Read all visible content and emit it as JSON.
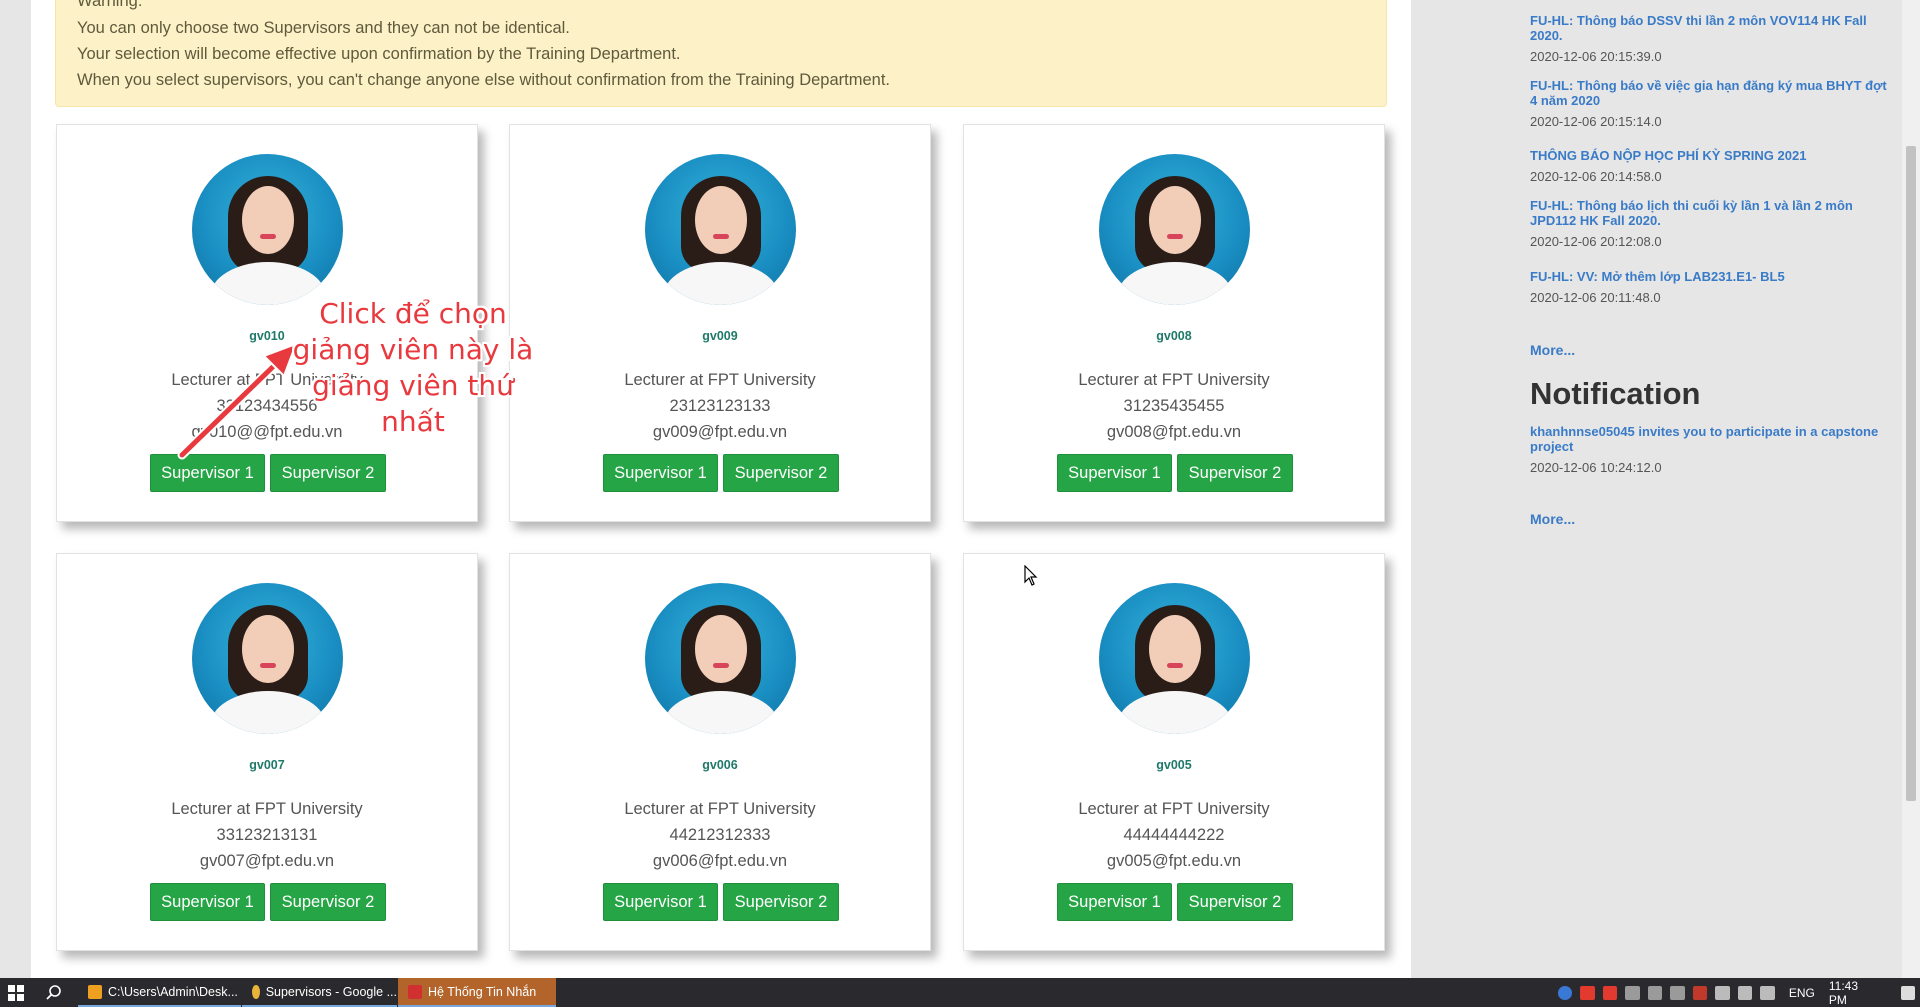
{
  "warning": {
    "lines": [
      "Warning:",
      "You can only choose two Supervisors and they can not be identical.",
      "Your selection will become effective upon confirmation by the Training Department.",
      "When you select supervisors, you can't change anyone else without confirmation from the Training Department."
    ]
  },
  "cards": [
    {
      "code": "gv010",
      "role": "Lecturer at FPT University",
      "phone": "33123434556",
      "email": "gv010@@fpt.edu.vn",
      "btn1": "Supervisor 1",
      "btn2": "Supervisor 2"
    },
    {
      "code": "gv009",
      "role": "Lecturer at FPT University",
      "phone": "23123123133",
      "email": "gv009@fpt.edu.vn",
      "btn1": "Supervisor 1",
      "btn2": "Supervisor 2"
    },
    {
      "code": "gv008",
      "role": "Lecturer at FPT University",
      "phone": "31235435455",
      "email": "gv008@fpt.edu.vn",
      "btn1": "Supervisor 1",
      "btn2": "Supervisor 2"
    },
    {
      "code": "gv007",
      "role": "Lecturer at FPT University",
      "phone": "33123213131",
      "email": "gv007@fpt.edu.vn",
      "btn1": "Supervisor 1",
      "btn2": "Supervisor 2"
    },
    {
      "code": "gv006",
      "role": "Lecturer at FPT University",
      "phone": "44212312333",
      "email": "gv006@fpt.edu.vn",
      "btn1": "Supervisor 1",
      "btn2": "Supervisor 2"
    },
    {
      "code": "gv005",
      "role": "Lecturer at FPT University",
      "phone": "44444444222",
      "email": "gv005@fpt.edu.vn",
      "btn1": "Supervisor 1",
      "btn2": "Supervisor 2"
    }
  ],
  "annotation": {
    "lines": [
      "Click để chọn",
      "giảng viên này là",
      "giảng viên thứ",
      "nhất"
    ]
  },
  "sidebar": {
    "news": [
      {
        "title": "FU-HL: Thông báo DSSV thi lần 2 môn VOV114 HK Fall 2020.",
        "date": "2020-12-06 20:15:39.0"
      },
      {
        "title": "FU-HL: Thông báo về việc gia hạn đăng ký mua BHYT đợt 4 năm 2020",
        "date": "2020-12-06 20:15:14.0"
      },
      {
        "title": "THÔNG BÁO NỘP HỌC PHÍ KỲ SPRING 2021",
        "date": "2020-12-06 20:14:58.0"
      },
      {
        "title": "FU-HL: Thông báo lịch thi cuối kỳ lần 1 và lần 2 môn JPD112 HK Fall 2020.",
        "date": "2020-12-06 20:12:08.0"
      },
      {
        "title": "FU-HL: VV: Mở thêm lớp LAB231.E1- BL5",
        "date": "2020-12-06 20:11:48.0"
      }
    ],
    "more1": "More...",
    "notification_heading": "Notification",
    "notifications": [
      {
        "title": "khanhnnse05045 invites you to participate in a capstone project",
        "date": "2020-12-06 10:24:12.0"
      }
    ],
    "more2": "More..."
  },
  "taskbar": {
    "tasks": [
      {
        "label": "C:\\Users\\Admin\\Desk...",
        "color": "#f0a020"
      },
      {
        "label": "Supervisors - Google ...",
        "color": "#e8b43a"
      },
      {
        "label": "Hệ Thống Tin Nhắn",
        "color": "#d23030"
      }
    ],
    "lang": "ENG",
    "time": "11:43 PM"
  }
}
